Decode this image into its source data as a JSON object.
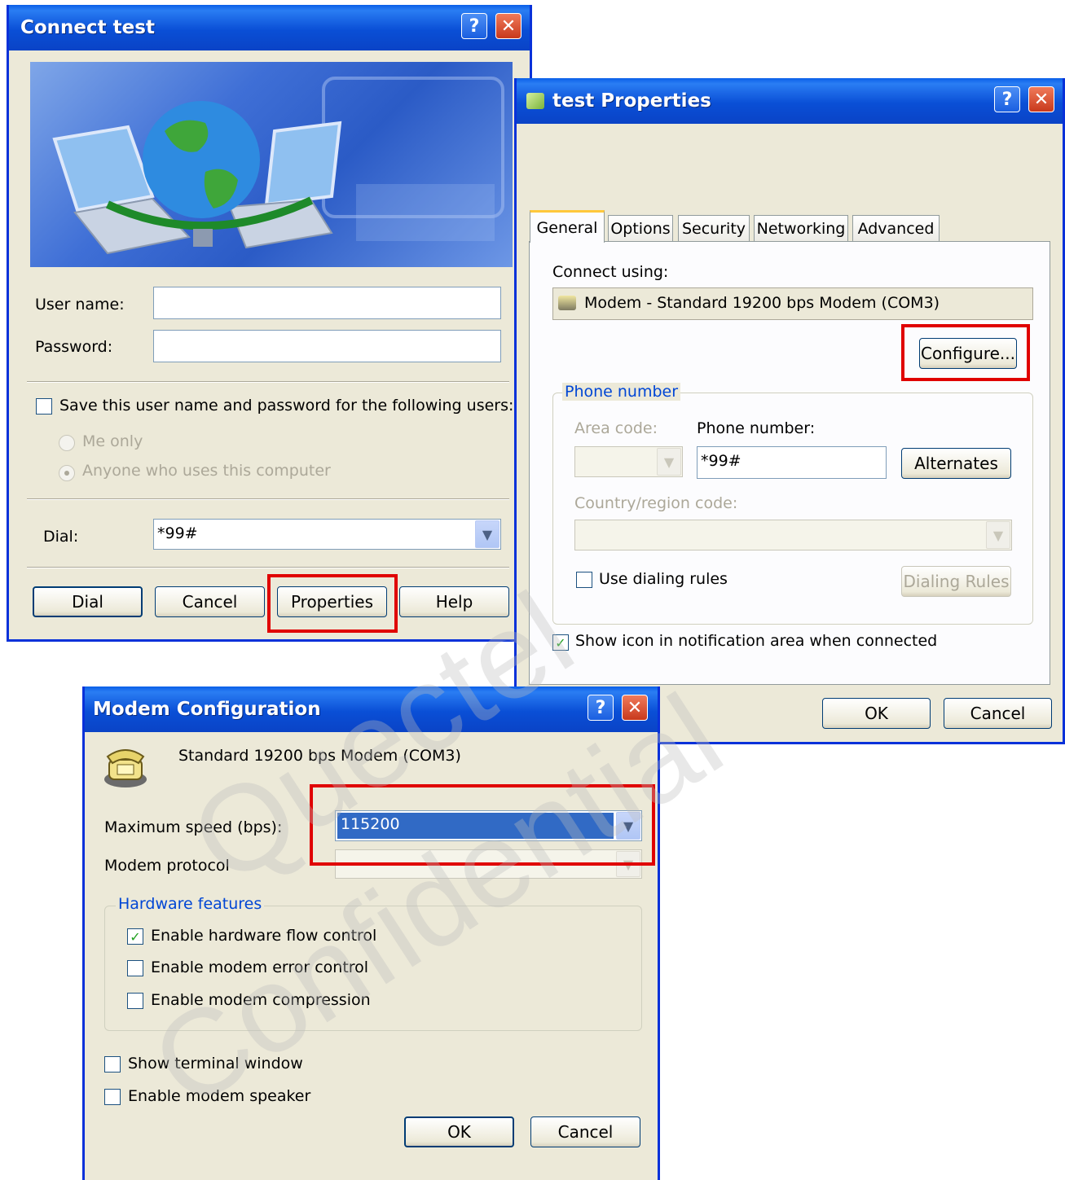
{
  "connect_dialog": {
    "title": "Connect test",
    "username_label": "User name:",
    "password_label": "Password:",
    "username_value": "",
    "password_value": "",
    "save_checkbox_label": "Save this user name and password for the following users:",
    "save_checked": false,
    "radio_me_only": "Me only",
    "radio_anyone": "Anyone who uses this computer",
    "dial_label": "Dial:",
    "dial_value": "*99#",
    "buttons": {
      "dial": "Dial",
      "cancel": "Cancel",
      "properties": "Properties",
      "help": "Help"
    }
  },
  "properties_dialog": {
    "title": "test Properties",
    "tabs": [
      "General",
      "Options",
      "Security",
      "Networking",
      "Advanced"
    ],
    "active_tab": "General",
    "connect_using_label": "Connect using:",
    "device": "Modem - Standard 19200 bps Modem (COM3)",
    "configure_button": "Configure...",
    "phone_group_label": "Phone number",
    "area_code_label": "Area code:",
    "phone_number_label": "Phone number:",
    "phone_number_value": "*99#",
    "alternates_button": "Alternates",
    "country_label": "Country/region code:",
    "use_dialing_rules_label": "Use dialing rules",
    "dialing_rules_button": "Dialing Rules",
    "show_icon_label": "Show icon in notification area when connected",
    "show_icon_checked": true,
    "ok_button": "OK",
    "cancel_button": "Cancel"
  },
  "modem_dialog": {
    "title": "Modem Configuration",
    "device_name": "Standard 19200 bps Modem (COM3)",
    "max_speed_label": "Maximum speed (bps):",
    "max_speed_value": "115200",
    "protocol_label": "Modem protocol",
    "hardware_group_label": "Hardware features",
    "flow_control_label": "Enable hardware flow control",
    "flow_control_checked": true,
    "error_control_label": "Enable modem error control",
    "compression_label": "Enable modem compression",
    "terminal_window_label": "Show terminal window",
    "speaker_label": "Enable modem speaker",
    "ok_button": "OK",
    "cancel_button": "Cancel"
  },
  "watermark": {
    "line1": "Quectel",
    "line2": "Confidential"
  },
  "icons": {
    "help": "?",
    "close": "✕",
    "check": "✓",
    "dropdown": "▼"
  },
  "colors": {
    "highlight": "#e00000",
    "title_blue": "#0a4fd6",
    "group_label": "#0046d5",
    "selection": "#316ac5"
  }
}
